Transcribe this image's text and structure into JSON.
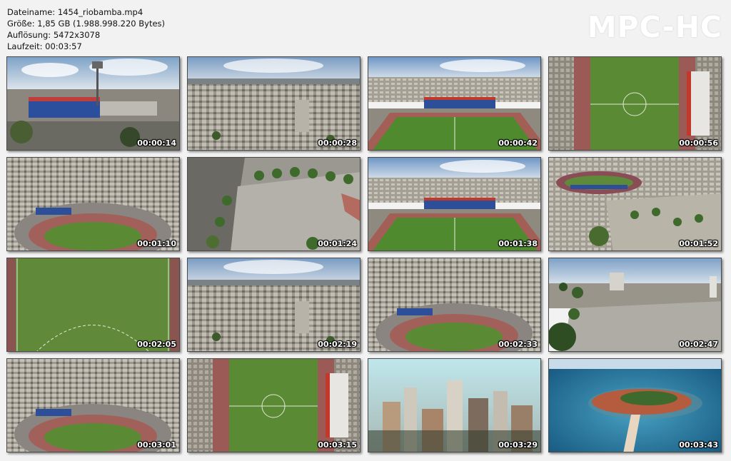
{
  "info": {
    "filename": "Dateiname: 1454_riobamba.mp4",
    "size": "Größe: 1,85 GB (1.988.998.220 Bytes)",
    "resolution": "Auflösung: 5472x3078",
    "duration": "Laufzeit: 00:03:57"
  },
  "logo": "MPC-HC",
  "thumbnails": [
    {
      "time": "00:00:14",
      "scene": "stadium-exterior"
    },
    {
      "time": "00:00:28",
      "scene": "city-aerial"
    },
    {
      "time": "00:00:42",
      "scene": "stadium-field"
    },
    {
      "time": "00:00:56",
      "scene": "field-topdown"
    },
    {
      "time": "00:01:10",
      "scene": "stadium-aerial"
    },
    {
      "time": "00:01:24",
      "scene": "plaza-aerial"
    },
    {
      "time": "00:01:38",
      "scene": "stadium-field"
    },
    {
      "time": "00:01:52",
      "scene": "park-stadium"
    },
    {
      "time": "00:02:05",
      "scene": "field-closeup"
    },
    {
      "time": "00:02:19",
      "scene": "city-aerial"
    },
    {
      "time": "00:02:33",
      "scene": "stadium-aerial"
    },
    {
      "time": "00:02:47",
      "scene": "plaza-trees"
    },
    {
      "time": "00:03:01",
      "scene": "stadium-aerial"
    },
    {
      "time": "00:03:15",
      "scene": "field-topdown"
    },
    {
      "time": "00:03:29",
      "scene": "skyscrapers"
    },
    {
      "time": "00:03:43",
      "scene": "island"
    }
  ]
}
